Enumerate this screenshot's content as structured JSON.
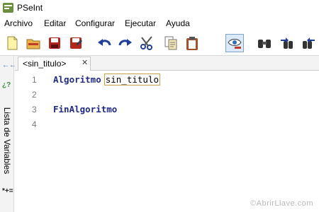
{
  "window": {
    "title": "PSeInt"
  },
  "menu": {
    "items": [
      "Archivo",
      "Editar",
      "Configurar",
      "Ejecutar",
      "Ayuda"
    ]
  },
  "toolbar": {
    "buttons": [
      {
        "icon": "new-file-icon"
      },
      {
        "icon": "open-folder-icon"
      },
      {
        "icon": "save-icon"
      },
      {
        "icon": "save-as-icon"
      },
      {
        "icon": "undo-icon"
      },
      {
        "icon": "redo-icon"
      },
      {
        "icon": "cut-icon"
      },
      {
        "icon": "copy-icon"
      },
      {
        "icon": "paste-icon"
      },
      {
        "icon": "reveal-icon",
        "active": true
      },
      {
        "icon": "find-icon"
      },
      {
        "icon": "find-previous-icon"
      },
      {
        "icon": "find-next-icon"
      }
    ]
  },
  "sidebar": {
    "symbols_top": "←←",
    "symbols_mid": "¿?",
    "vertical_label": "Lista de Variables",
    "symbols_bottom": "*+="
  },
  "tab": {
    "label": "<sin_titulo>",
    "close": "✕"
  },
  "editor": {
    "lines": [
      {
        "number": "1",
        "keyword": "Algoritmo",
        "identifier": "sin_titulo"
      },
      {
        "number": "2",
        "keyword": "",
        "identifier": ""
      },
      {
        "number": "3",
        "keyword": "FinAlgoritmo",
        "identifier": ""
      },
      {
        "number": "4",
        "keyword": "",
        "identifier": ""
      }
    ]
  },
  "watermark": "©AbrirLlave.com",
  "colors": {
    "keyword": "#1f2a8a",
    "active_button_bg": "#dbe9f8",
    "identifier_box": "#c8a24a"
  }
}
